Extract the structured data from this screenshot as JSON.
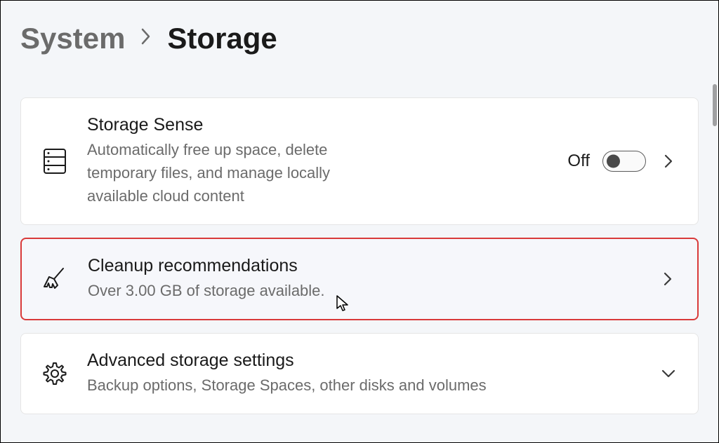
{
  "breadcrumb": {
    "parent": "System",
    "current": "Storage"
  },
  "cards": {
    "storage_sense": {
      "title": "Storage Sense",
      "subtitle": "Automatically free up space, delete temporary files, and manage locally available cloud content",
      "toggle_state": "Off"
    },
    "cleanup": {
      "title": "Cleanup recommendations",
      "subtitle": "Over 3.00 GB of storage available."
    },
    "advanced": {
      "title": "Advanced storage settings",
      "subtitle": "Backup options, Storage Spaces, other disks and volumes"
    }
  }
}
